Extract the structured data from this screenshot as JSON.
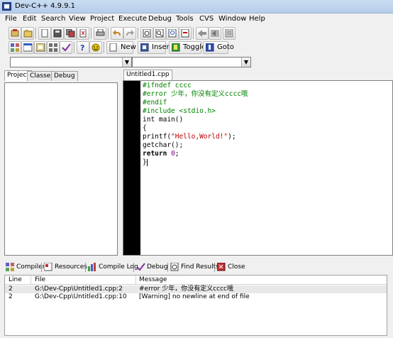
{
  "window": {
    "title": "Dev-C++ 4.9.9.1"
  },
  "menu": [
    "File",
    "Edit",
    "Search",
    "View",
    "Project",
    "Execute",
    "Debug",
    "Tools",
    "CVS",
    "Window",
    "Help"
  ],
  "toolbar2": {
    "new_label": "New",
    "insert_label": "Insert",
    "toggle_label": "Toggle",
    "goto_label": "Goto"
  },
  "combos": {
    "class_value": "",
    "member_value": ""
  },
  "left_tabs": [
    "Project",
    "Classes",
    "Debug"
  ],
  "editor_tab": "Untitled1.cpp",
  "code": {
    "l1": "#ifndef cccc",
    "l2": "#error 少年，你没有定义cccc哦",
    "l3": "#endif",
    "l4": "#include <stdio.h>",
    "l5": "int main()",
    "l6": "{",
    "l7a": "printf(",
    "l7b": "\"Hello,World!\"",
    "l7c": ");",
    "l8": "getchar();",
    "l9a": "return",
    "l9b": " ",
    "l9c": "0",
    "l9d": ";",
    "l10": "}"
  },
  "bottom_tabs": [
    "Compiler",
    "Resources",
    "Compile Log",
    "Debug",
    "Find Results",
    "Close"
  ],
  "messages": {
    "columns": [
      "Line",
      "File",
      "Message"
    ],
    "rows": [
      {
        "line": "2",
        "file": "G:\\Dev-Cpp\\Untitled1.cpp:2",
        "message": "#error 少年，你没有定义cccc哦"
      },
      {
        "line": "2",
        "file": "G:\\Dev-Cpp\\Untitled1.cpp:10",
        "message": "[Warning] no newline at end of file"
      }
    ]
  },
  "colors": {
    "preprocessor": "#008000",
    "string": "#c00000",
    "number": "#800080",
    "gutter": "#000000"
  }
}
